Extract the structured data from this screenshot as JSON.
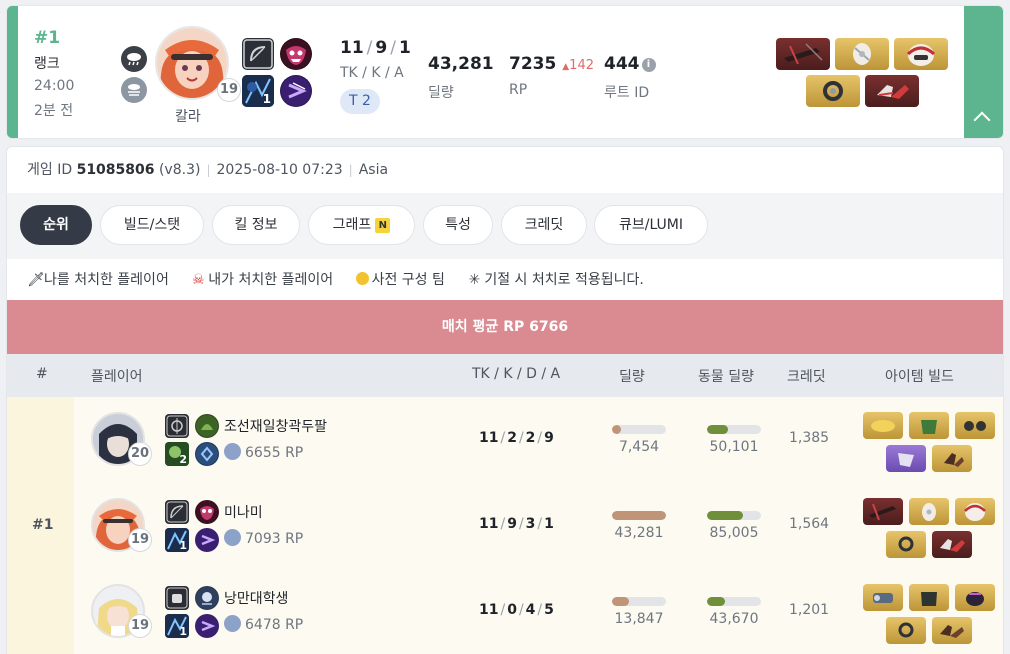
{
  "summary": {
    "rank": "#1",
    "rank_label": "랭크",
    "duration": "24:00",
    "ago": "2분 전",
    "character_name": "칼라",
    "level": "19",
    "kda": {
      "tk": "11",
      "k": "9",
      "a": "1",
      "label": "TK / K / A"
    },
    "tier": "T 2",
    "damage": {
      "value": "43,281",
      "label": "딜량"
    },
    "rp": {
      "value": "7235",
      "delta": "142",
      "label": "RP"
    },
    "route": {
      "value": "444",
      "label": "루트 ID"
    },
    "icons": [
      "rain-weather-icon",
      "fog-weather-icon",
      "bow-weapon-icon",
      "demon-mask-trait-icon",
      "tactical-skill-icon",
      "augment-icon"
    ],
    "colors": {
      "accent": "#5cb58e",
      "delta": "#e06b6b"
    }
  },
  "game": {
    "id_label": "게임 ID",
    "id": "51085806",
    "version": "(v8.3)",
    "datetime": "2025-08-10 07:23",
    "region": "Asia"
  },
  "tabs": [
    "순위",
    "빌드/스탯",
    "킬 정보",
    "그래프",
    "특성",
    "크레딧",
    "큐브/LUMI"
  ],
  "tab_badge": "N",
  "legend": {
    "killed_me": "나를 처치한 플레이어",
    "i_killed": "내가 처치한 플레이어",
    "premade": "사전 구성 팀",
    "note": "기절 시 처치로 적용됩니다."
  },
  "match_avg": "매치 평균 RP 6766",
  "table_headers": {
    "rank": "#",
    "player": "플레이어",
    "kda": "TK / K / D / A",
    "damage": "딜량",
    "animal_damage": "동물 딜량",
    "credit": "크레딧",
    "items": "아이템 빌드"
  },
  "team": {
    "rank": "#1",
    "players": [
      {
        "name": "조선재일창곽두팔",
        "level": "20",
        "rp": "6655 RP",
        "tk": "11",
        "k": "2",
        "d": "2",
        "a": "9",
        "damage": "7,454",
        "damage_fraction": 0.17,
        "animal_damage": "50,101",
        "animal_fraction": 0.38,
        "credit": "1,385"
      },
      {
        "name": "미나미",
        "level": "19",
        "rp": "7093 RP",
        "tk": "11",
        "k": "9",
        "d": "3",
        "a": "1",
        "damage": "43,281",
        "damage_fraction": 1.0,
        "animal_damage": "85,005",
        "animal_fraction": 0.66,
        "credit": "1,564"
      },
      {
        "name": "낭만대학생",
        "level": "19",
        "rp": "6478 RP",
        "tk": "11",
        "k": "0",
        "d": "4",
        "a": "5",
        "damage": "13,847",
        "damage_fraction": 0.32,
        "animal_damage": "43,670",
        "animal_fraction": 0.33,
        "credit": "1,201"
      }
    ]
  }
}
